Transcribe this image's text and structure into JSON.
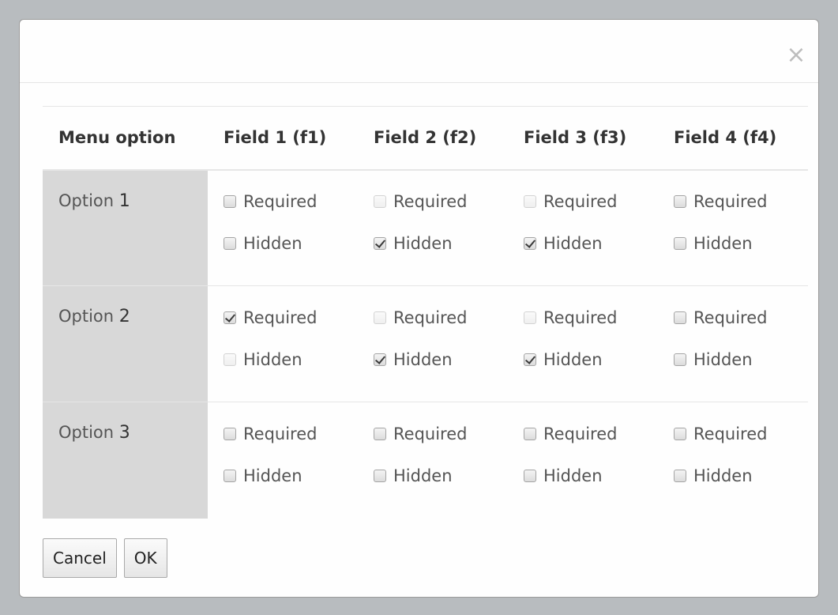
{
  "dialog": {
    "close_glyph": "×"
  },
  "table": {
    "headers": [
      "Menu option",
      "Field 1 (f1)",
      "Field 2 (f2)",
      "Field 3 (f3)",
      "Field 4 (f4)"
    ],
    "rows": [
      {
        "option_prefix": "Option ",
        "option_number": "1",
        "fields": [
          {
            "required": {
              "label": "Required",
              "checked": false,
              "disabled": false
            },
            "hidden": {
              "label": "Hidden",
              "checked": false,
              "disabled": false
            }
          },
          {
            "required": {
              "label": "Required",
              "checked": false,
              "disabled": true
            },
            "hidden": {
              "label": "Hidden",
              "checked": true,
              "disabled": false
            }
          },
          {
            "required": {
              "label": "Required",
              "checked": false,
              "disabled": true
            },
            "hidden": {
              "label": "Hidden",
              "checked": true,
              "disabled": false
            }
          },
          {
            "required": {
              "label": "Required",
              "checked": false,
              "disabled": false
            },
            "hidden": {
              "label": "Hidden",
              "checked": false,
              "disabled": false
            }
          }
        ]
      },
      {
        "option_prefix": "Option ",
        "option_number": "2",
        "fields": [
          {
            "required": {
              "label": "Required",
              "checked": true,
              "disabled": false
            },
            "hidden": {
              "label": "Hidden",
              "checked": false,
              "disabled": true
            }
          },
          {
            "required": {
              "label": "Required",
              "checked": false,
              "disabled": true
            },
            "hidden": {
              "label": "Hidden",
              "checked": true,
              "disabled": false
            }
          },
          {
            "required": {
              "label": "Required",
              "checked": false,
              "disabled": true
            },
            "hidden": {
              "label": "Hidden",
              "checked": true,
              "disabled": false
            }
          },
          {
            "required": {
              "label": "Required",
              "checked": false,
              "disabled": false
            },
            "hidden": {
              "label": "Hidden",
              "checked": false,
              "disabled": false
            }
          }
        ]
      },
      {
        "option_prefix": "Option ",
        "option_number": "3",
        "fields": [
          {
            "required": {
              "label": "Required",
              "checked": false,
              "disabled": false
            },
            "hidden": {
              "label": "Hidden",
              "checked": false,
              "disabled": false
            }
          },
          {
            "required": {
              "label": "Required",
              "checked": false,
              "disabled": false
            },
            "hidden": {
              "label": "Hidden",
              "checked": false,
              "disabled": false
            }
          },
          {
            "required": {
              "label": "Required",
              "checked": false,
              "disabled": false
            },
            "hidden": {
              "label": "Hidden",
              "checked": false,
              "disabled": false
            }
          },
          {
            "required": {
              "label": "Required",
              "checked": false,
              "disabled": false
            },
            "hidden": {
              "label": "Hidden",
              "checked": false,
              "disabled": false
            }
          }
        ]
      }
    ]
  },
  "footer": {
    "cancel_label": "Cancel",
    "ok_label": "OK"
  },
  "colors": {
    "backdrop": "#b8bcbf",
    "option_cell_bg": "#d8d8d8",
    "close_icon": "#bdbdbd"
  },
  "icons": {
    "close": "close-icon",
    "checkbox": "checkbox-icon",
    "checkmark": "checkmark-icon"
  }
}
